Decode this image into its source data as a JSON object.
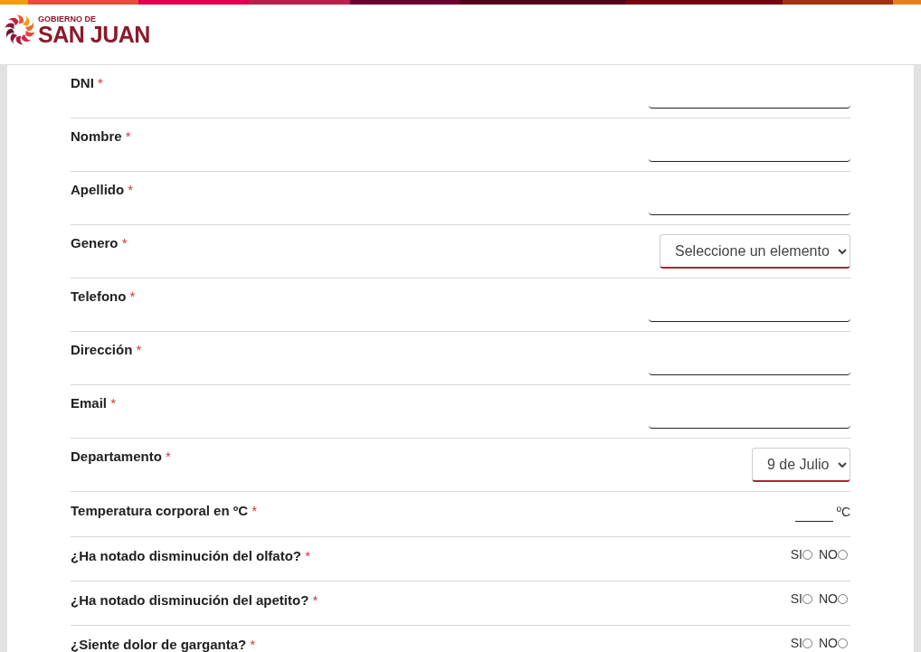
{
  "logo": {
    "top_line": "GOBIERNO DE",
    "main_line": "SAN JUAN"
  },
  "fields": [
    {
      "kind": "text",
      "label": "DNI",
      "mark": "*"
    },
    {
      "kind": "text",
      "label": "Nombre",
      "mark": "*"
    },
    {
      "kind": "text",
      "label": "Apellido",
      "mark": "*"
    },
    {
      "kind": "select",
      "label": "Genero",
      "mark": "*",
      "value": "Seleccione un elemento"
    },
    {
      "kind": "text",
      "label": "Telefono",
      "mark": "*"
    },
    {
      "kind": "text",
      "label": "Dirección",
      "mark": "*"
    },
    {
      "kind": "text",
      "label": "Email",
      "mark": "*"
    },
    {
      "kind": "select",
      "label": "Departamento",
      "mark": "*",
      "value": "9 de Julio"
    },
    {
      "kind": "temperature",
      "label": "Temperatura corporal en ºC",
      "mark": "*",
      "unit": "ºC"
    },
    {
      "kind": "yesno",
      "label": "¿Ha notado disminución del olfato?",
      "mark": "*",
      "options": [
        {
          "label": "SI",
          "selected": false
        },
        {
          "label": "NO",
          "selected": false
        }
      ]
    },
    {
      "kind": "yesno",
      "label": "¿Ha notado disminución del apetito?",
      "mark": "*",
      "options": [
        {
          "label": "SI",
          "selected": false
        },
        {
          "label": "NO",
          "selected": false
        }
      ]
    },
    {
      "kind": "yesno",
      "label": "¿Siente dolor de garganta?",
      "mark": "*",
      "options": [
        {
          "label": "SI",
          "selected": false
        },
        {
          "label": "NO",
          "selected": false
        }
      ]
    }
  ]
}
